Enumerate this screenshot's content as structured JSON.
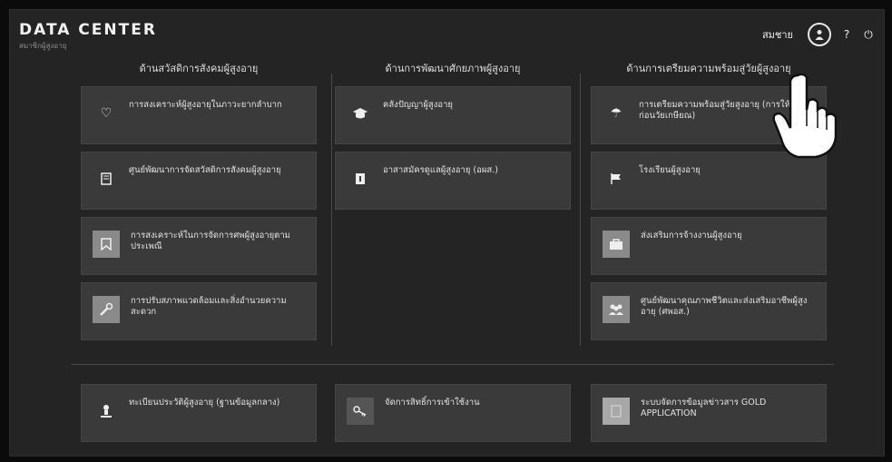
{
  "header": {
    "title": "DATA CENTER",
    "subtitle": "สมาชิกผู้สูงอายุ",
    "user_name": "สมชาย"
  },
  "icons": {
    "profile": "profile-icon",
    "help": "help-icon",
    "power": "power-icon"
  },
  "columns": [
    {
      "heading": "ด้านสวัสดิการสังคมผู้สูงอายุ",
      "cards": [
        {
          "label": "การสงเคราะห์ผู้สูงอายุในภาวะยากลำบาก",
          "icon": "heart-icon"
        },
        {
          "label": "ศูนย์พัฒนาการจัดสวัสดิการสังคมผู้สูงอายุ",
          "icon": "book-icon"
        },
        {
          "label": "การสงเคราะห์ในการจัดการศพผู้สูงอายุตามประเพณี",
          "icon": "bookmark-icon"
        },
        {
          "label": "การปรับสภาพแวดล้อมและสิ่งอำนวยความสะดวก",
          "icon": "wrench-icon"
        }
      ]
    },
    {
      "heading": "ด้านการพัฒนาศักยภาพผู้สูงอายุ",
      "cards": [
        {
          "label": "คลังปัญญาผู้สูงอายุ",
          "icon": "graduation-cap-icon"
        },
        {
          "label": "อาสาสมัครดูแลผู้สูงอายุ (อผส.)",
          "icon": "badge-icon"
        }
      ]
    },
    {
      "heading": "ด้านการเตรียมความพร้อมสู่วัยผู้สูงอายุ",
      "cards": [
        {
          "label": "การเตรียมความพร้อมสู่วัยสูงอายุ (การให้ความรู้ก่อนวัยเกษียณ)",
          "icon": "umbrella-icon"
        },
        {
          "label": "โรงเรียนผู้สูงอายุ",
          "icon": "flag-icon"
        },
        {
          "label": "ส่งเสริมการจ้างงานผู้สูงอายุ",
          "icon": "briefcase-icon"
        },
        {
          "label": "ศูนย์พัฒนาคุณภาพชีวิตและส่งเสริมอาชีพผู้สูงอายุ (ศพอส.)",
          "icon": "group-icon"
        }
      ]
    }
  ],
  "bottom_cards": [
    {
      "label": "ทะเบียนประวัติผู้สูงอายุ (ฐานข้อมูลกลาง)",
      "icon": "person-icon"
    },
    {
      "label": "จัดการสิทธิ์การเข้าใช้งาน",
      "icon": "key-icon"
    },
    {
      "label": "ระบบจัดการข้อมูลข่าวสาร GOLD APPLICATION",
      "icon": "document-icon"
    }
  ]
}
